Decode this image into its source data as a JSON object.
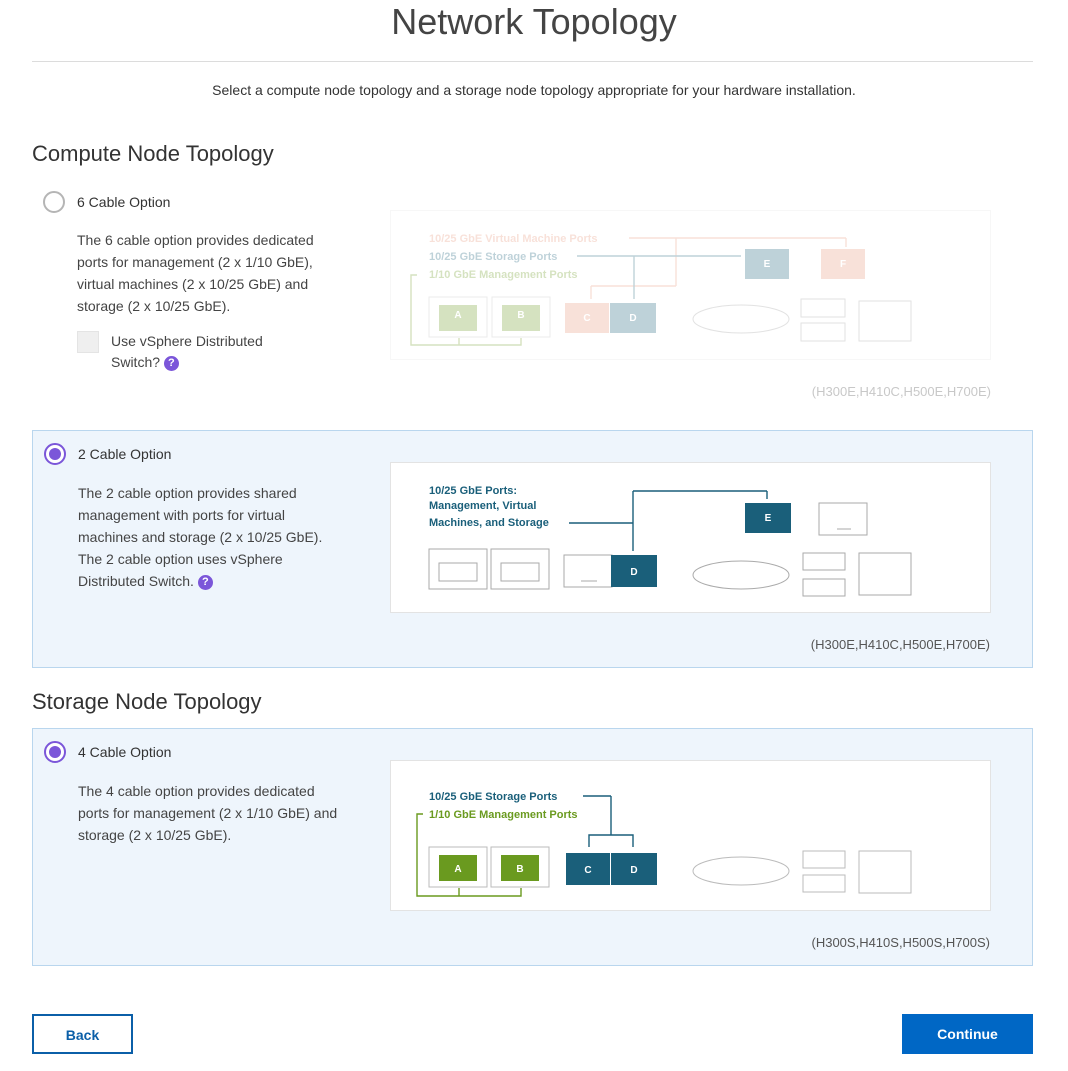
{
  "header": {
    "title": "Network Topology",
    "subtitle": "Select a compute node topology and a storage node topology appropriate for your hardware installation."
  },
  "compute": {
    "heading": "Compute Node Topology",
    "options": [
      {
        "label": "6 Cable Option",
        "selected": false,
        "description": "The 6 cable option provides dedicated ports for management (2 x 1/10 GbE), virtual machines (2 x 10/25 GbE) and storage (2 x 10/25 GbE).",
        "checkbox_label": "Use vSphere Distributed Switch?",
        "diagram_labels": {
          "vm_ports": "10/25 GbE Virtual Machine Ports",
          "storage_ports": "10/25 GbE Storage Ports",
          "mgmt_ports": "1/10 GbE Management Ports"
        },
        "ports": [
          "A",
          "B",
          "C",
          "D",
          "E",
          "F"
        ],
        "models": "(H300E,H410C,H500E,H700E)"
      },
      {
        "label": "2 Cable Option",
        "selected": true,
        "description": "The 2 cable option provides shared management with ports for virtual machines and storage (2 x 10/25 GbE). The 2 cable option uses vSphere Distributed Switch.",
        "diagram_labels": {
          "line1": "10/25 GbE Ports:",
          "line2": "Management, Virtual",
          "line3": "Machines, and Storage"
        },
        "ports": [
          "D",
          "E"
        ],
        "models": "(H300E,H410C,H500E,H700E)"
      }
    ]
  },
  "storage": {
    "heading": "Storage Node Topology",
    "options": [
      {
        "label": "4 Cable Option",
        "selected": true,
        "description": "The 4 cable option provides dedicated ports for management (2 x 1/10 GbE) and storage (2 x 10/25 GbE).",
        "diagram_labels": {
          "storage_ports": "10/25 GbE Storage Ports",
          "mgmt_ports": "1/10 GbE Management Ports"
        },
        "ports": [
          "A",
          "B",
          "C",
          "D"
        ],
        "models": "(H300S,H410S,H500S,H700S)"
      }
    ]
  },
  "footer": {
    "back_label": "Back",
    "continue_label": "Continue"
  },
  "colors": {
    "accent_radio": "#7b56d9",
    "primary_button": "#0067c5",
    "vm_port": "#e9967a",
    "storage_port": "#1a5f7a",
    "mgmt_port": "#6a9a1f"
  }
}
